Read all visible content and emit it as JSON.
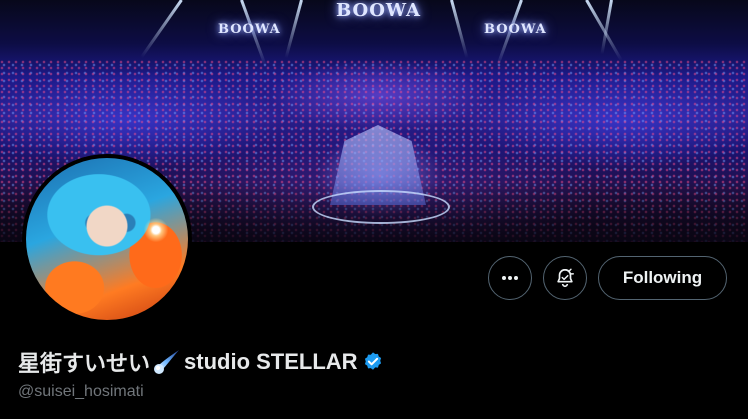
{
  "banner": {
    "signs": [
      "BOOWA",
      "BOOWA",
      "BOOWA"
    ]
  },
  "actions": {
    "more_icon": "more-horizontal-icon",
    "notify_icon": "bell-notification-icon",
    "following_label": "Following"
  },
  "profile": {
    "name_prefix": "星街すいせい",
    "name_emoji": "comet-icon",
    "name_suffix": "studio STELLAR",
    "verified_icon": "verified-badge-icon",
    "handle": "@suisei_hosimati"
  },
  "colors": {
    "background": "#000000",
    "verified_blue": "#1d9bf0",
    "handle_gray": "#71767b",
    "button_border": "#536471"
  }
}
